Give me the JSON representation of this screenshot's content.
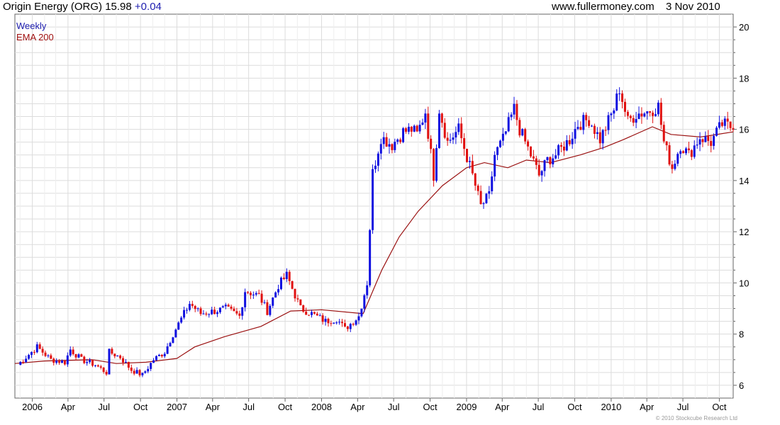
{
  "header": {
    "title": "Origin Energy (ORG) 15.98",
    "change": "+0.04",
    "site": "www.fullermoney.com",
    "date": "3 Nov 2010"
  },
  "legend": {
    "weekly": "Weekly",
    "ema": "EMA 200"
  },
  "copyright": "© 2010 Stockcube Research Ltd",
  "colors": {
    "up": "#1010e0",
    "down": "#e01010",
    "ema": "#9a1010",
    "grid": "#dcdcdc",
    "blue_text": "#2020b0",
    "red_text": "#a01010"
  },
  "chart_data": {
    "type": "candlestick",
    "x_tick_labels": [
      "2006",
      "Apr",
      "Jul",
      "Oct",
      "2007",
      "Apr",
      "Jul",
      "Oct",
      "2008",
      "Apr",
      "Jul",
      "Oct",
      "2009",
      "Apr",
      "Jul",
      "Oct",
      "2010",
      "Apr",
      "Jul",
      "Oct"
    ],
    "y_ticks": [
      6,
      8,
      10,
      12,
      14,
      16,
      18,
      20
    ],
    "y_axis_position": "right",
    "ylim": [
      5.5,
      20.5
    ],
    "xlim": [
      "2005-11-18",
      "2010-11-05"
    ],
    "grid": true,
    "legend_position": "top-left",
    "series": [
      {
        "name": "Weekly",
        "kind": "candles",
        "points": [
          [
            "2005-11-25",
            6.8
          ],
          [
            "2006-01-13",
            7.5
          ],
          [
            "2006-02-17",
            7.0
          ],
          [
            "2006-03-24",
            6.9
          ],
          [
            "2006-04-07",
            7.4
          ],
          [
            "2006-05-05",
            7.0
          ],
          [
            "2006-06-09",
            6.8
          ],
          [
            "2006-07-07",
            6.5
          ],
          [
            "2006-07-14",
            7.3
          ],
          [
            "2006-08-11",
            7.1
          ],
          [
            "2006-09-08",
            6.6
          ],
          [
            "2006-10-06",
            6.4
          ],
          [
            "2006-11-03",
            7.0
          ],
          [
            "2006-12-01",
            7.3
          ],
          [
            "2006-12-22",
            8.0
          ],
          [
            "2007-02-02",
            9.2
          ],
          [
            "2007-03-02",
            8.8
          ],
          [
            "2007-04-06",
            8.9
          ],
          [
            "2007-05-04",
            9.0
          ],
          [
            "2007-06-08",
            8.7
          ],
          [
            "2007-06-22",
            9.7
          ],
          [
            "2007-07-27",
            9.5
          ],
          [
            "2007-08-17",
            8.9
          ],
          [
            "2007-09-14",
            9.9
          ],
          [
            "2007-10-05",
            10.3
          ],
          [
            "2007-11-09",
            9.0
          ],
          [
            "2007-12-07",
            8.8
          ],
          [
            "2008-01-11",
            8.5
          ],
          [
            "2008-02-08",
            8.6
          ],
          [
            "2008-02-29",
            8.2
          ],
          [
            "2008-04-04",
            8.7
          ],
          [
            "2008-04-25",
            10.0
          ],
          [
            "2008-05-09",
            14.3
          ],
          [
            "2008-05-30",
            15.7
          ],
          [
            "2008-06-27",
            15.4
          ],
          [
            "2008-07-25",
            15.9
          ],
          [
            "2008-08-15",
            16.0
          ],
          [
            "2008-08-29",
            15.8
          ],
          [
            "2008-09-19",
            16.7
          ],
          [
            "2008-10-10",
            14.2
          ],
          [
            "2008-10-24",
            16.8
          ],
          [
            "2008-11-14",
            15.5
          ],
          [
            "2008-12-12",
            16.0
          ],
          [
            "2009-01-16",
            14.2
          ],
          [
            "2009-02-06",
            13.0
          ],
          [
            "2009-02-27",
            13.4
          ],
          [
            "2009-03-13",
            15.0
          ],
          [
            "2009-04-03",
            15.6
          ],
          [
            "2009-05-01",
            16.8
          ],
          [
            "2009-05-15",
            16.0
          ],
          [
            "2009-06-12",
            15.0
          ],
          [
            "2009-07-03",
            14.2
          ],
          [
            "2009-07-24",
            14.8
          ],
          [
            "2009-08-14",
            15.0
          ],
          [
            "2009-09-18",
            15.6
          ],
          [
            "2009-10-09",
            16.2
          ],
          [
            "2009-11-06",
            16.4
          ],
          [
            "2009-12-04",
            15.6
          ],
          [
            "2010-01-08",
            16.8
          ],
          [
            "2010-01-22",
            17.6
          ],
          [
            "2010-02-12",
            16.3
          ],
          [
            "2010-03-05",
            16.6
          ],
          [
            "2010-04-02",
            16.7
          ],
          [
            "2010-04-30",
            16.9
          ],
          [
            "2010-05-14",
            15.5
          ],
          [
            "2010-06-04",
            14.5
          ],
          [
            "2010-06-25",
            15.4
          ],
          [
            "2010-07-16",
            15.0
          ],
          [
            "2010-08-13",
            15.7
          ],
          [
            "2010-09-10",
            15.5
          ],
          [
            "2010-10-08",
            16.2
          ],
          [
            "2010-10-29",
            16.1
          ],
          [
            "2010-11-05",
            15.98
          ]
        ]
      },
      {
        "name": "EMA 200",
        "kind": "line",
        "points": [
          [
            "2005-11-18",
            6.85
          ],
          [
            "2006-02-01",
            6.95
          ],
          [
            "2006-06-01",
            7.0
          ],
          [
            "2006-08-01",
            6.85
          ],
          [
            "2006-10-15",
            6.9
          ],
          [
            "2007-01-01",
            7.05
          ],
          [
            "2007-02-15",
            7.5
          ],
          [
            "2007-05-01",
            7.9
          ],
          [
            "2007-08-01",
            8.3
          ],
          [
            "2007-10-15",
            8.9
          ],
          [
            "2008-01-01",
            8.95
          ],
          [
            "2008-04-15",
            8.8
          ],
          [
            "2008-06-01",
            10.5
          ],
          [
            "2008-07-15",
            11.8
          ],
          [
            "2008-09-01",
            12.8
          ],
          [
            "2008-11-01",
            13.8
          ],
          [
            "2009-01-01",
            14.5
          ],
          [
            "2009-02-15",
            14.7
          ],
          [
            "2009-04-15",
            14.5
          ],
          [
            "2009-06-01",
            14.8
          ],
          [
            "2009-08-01",
            14.7
          ],
          [
            "2009-10-15",
            15.0
          ],
          [
            "2009-12-15",
            15.3
          ],
          [
            "2010-02-01",
            15.6
          ],
          [
            "2010-04-15",
            16.1
          ],
          [
            "2010-06-01",
            15.8
          ],
          [
            "2010-08-15",
            15.7
          ],
          [
            "2010-11-05",
            15.9
          ]
        ]
      }
    ]
  }
}
